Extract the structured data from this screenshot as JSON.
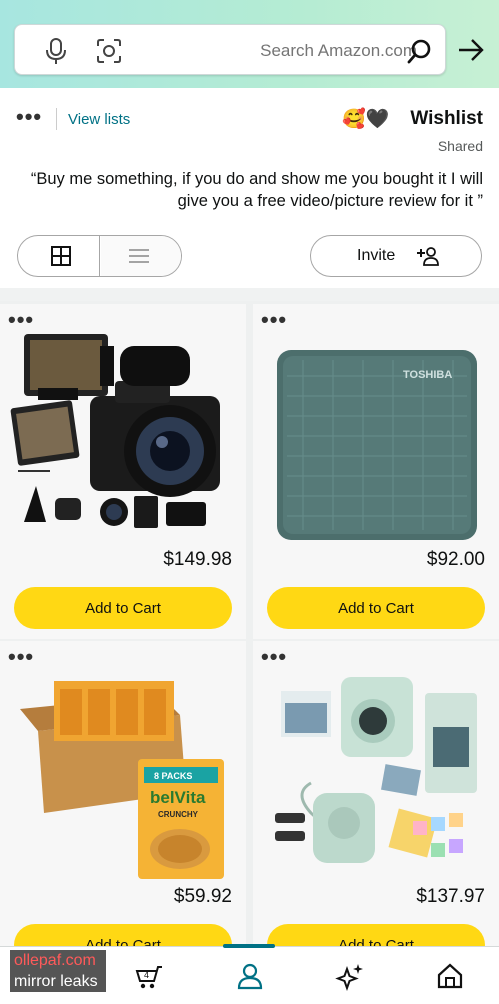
{
  "search": {
    "placeholder": "Search Amazon.com"
  },
  "wishlist": {
    "title": "Wishlist",
    "emoji": "🥰🖤",
    "visibility": "Shared",
    "description": "“Buy me something, if you do and show me you bought it I will give you a free video/picture review for it ”",
    "view_lists_label": "View lists",
    "invite_label": "Invite",
    "more_menu": "•••"
  },
  "products": [
    {
      "name": "External hard drive",
      "price": "$92.00",
      "cart_label": "Add to Cart",
      "brand_text": "TOSHIBA"
    },
    {
      "name": "Digital camera kit",
      "price": "$149.98",
      "cart_label": "Add to Cart"
    },
    {
      "name": "Instant camera bundle",
      "price": "$137.97",
      "cart_label": "Add to Cart"
    },
    {
      "name": "Biscuit multipack",
      "price": "$59.92",
      "cart_label": "Add to Cart",
      "box_text": "belVita",
      "pack_text": "8 PACKS",
      "flavor_text": "CRUNCHY"
    }
  ],
  "watermark": {
    "line1": "ollepaf.com",
    "line2": "mirror leaks"
  },
  "colors": {
    "accent": "#007185",
    "cart_button": "#ffd814",
    "header_gradient_start": "#a7e6e0",
    "header_gradient_end": "#c7f0d4"
  },
  "icons": [
    "microphone-icon",
    "camera-scan-icon",
    "search-icon",
    "back-arrow-icon",
    "grid-view-icon",
    "list-view-icon",
    "add-person-icon",
    "cart-icon",
    "account-icon",
    "sparkle-icon",
    "home-icon"
  ]
}
